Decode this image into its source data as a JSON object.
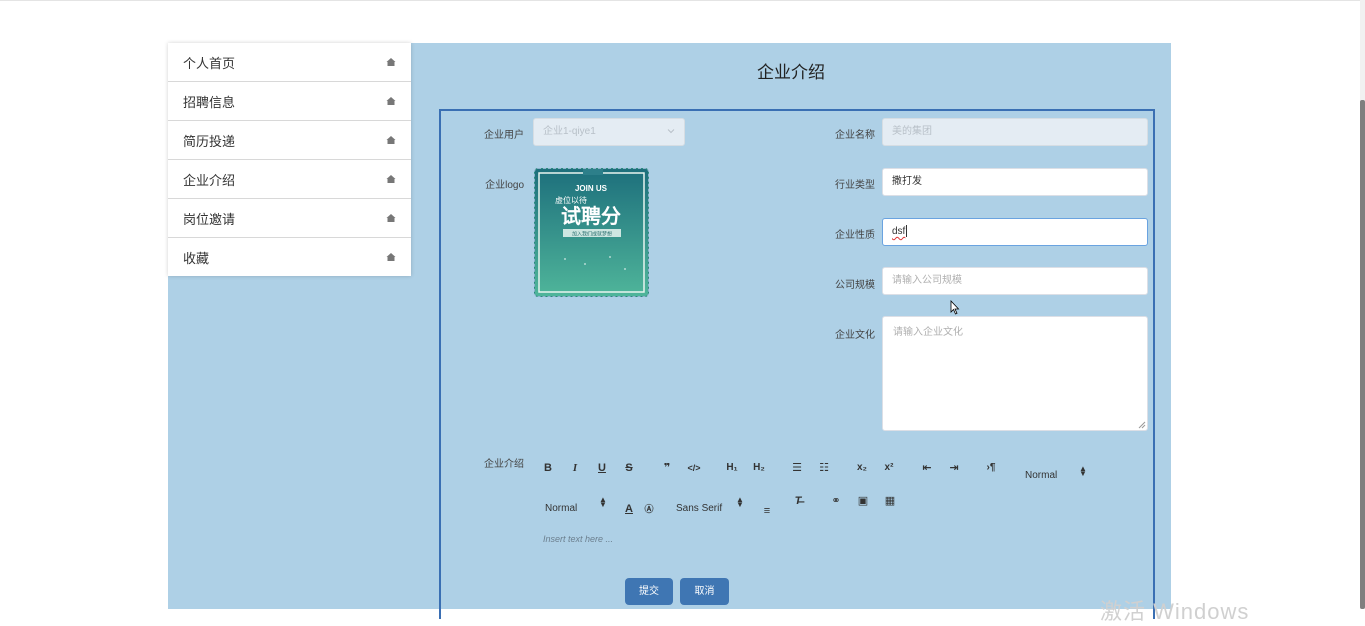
{
  "sidebar": {
    "items": [
      {
        "label": "个人首页",
        "icon": "home-icon"
      },
      {
        "label": "招聘信息",
        "icon": "home-icon"
      },
      {
        "label": "简历投递",
        "icon": "home-icon"
      },
      {
        "label": "企业介绍",
        "icon": "home-icon"
      },
      {
        "label": "岗位邀请",
        "icon": "home-icon"
      },
      {
        "label": "收藏",
        "icon": "home-icon"
      }
    ]
  },
  "page": {
    "title": "企业介绍"
  },
  "form": {
    "company_user": {
      "label": "企业用户",
      "value": "企业1-qiye1"
    },
    "company_name": {
      "label": "企业名称",
      "value": "美的集团"
    },
    "logo": {
      "label": "企业logo",
      "image_text_top": "JOIN US",
      "image_text_mid": "虚位以待",
      "image_text_big": "试聘分",
      "image_text_sub": "加入我们成就梦想"
    },
    "industry_type": {
      "label": "行业类型",
      "value": "撒打发"
    },
    "company_nature": {
      "label": "企业性质",
      "value": "dsf"
    },
    "company_size": {
      "label": "公司规模",
      "placeholder": "请输入公司规模"
    },
    "company_culture": {
      "label": "企业文化",
      "placeholder": "请输入企业文化"
    },
    "company_intro": {
      "label": "企业介绍",
      "toolbar": {
        "header_select": "Normal",
        "size_select": "Normal",
        "font_select": "Sans Serif"
      },
      "placeholder": "Insert text here ..."
    },
    "submit_label": "提交",
    "cancel_label": "取消"
  },
  "watermark": "激活 Windows",
  "colors": {
    "page_bg": "#aed0e6",
    "accent": "#3f76b3",
    "border": "#3a6fb3"
  }
}
